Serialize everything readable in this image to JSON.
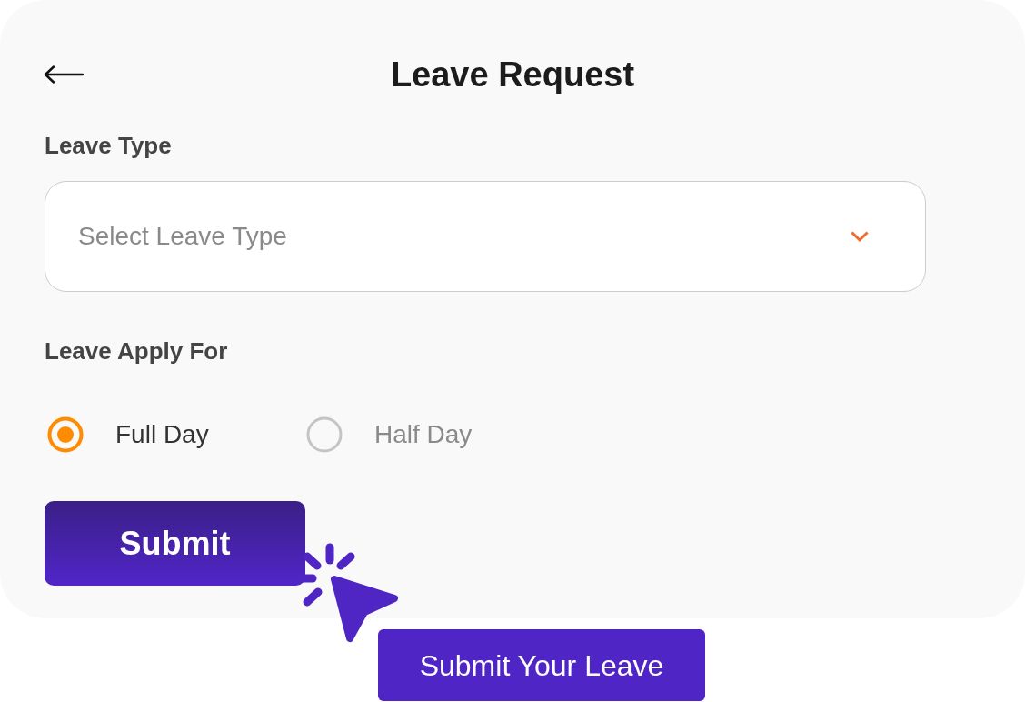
{
  "header": {
    "title": "Leave Request"
  },
  "leave_type": {
    "label": "Leave Type",
    "placeholder": "Select Leave Type"
  },
  "leave_apply_for": {
    "label": "Leave Apply For",
    "options": [
      {
        "label": "Full Day",
        "selected": true
      },
      {
        "label": "Half Day",
        "selected": false
      }
    ]
  },
  "submit_button": {
    "label": "Submit"
  },
  "callout": {
    "label": "Submit Your Leave"
  }
}
